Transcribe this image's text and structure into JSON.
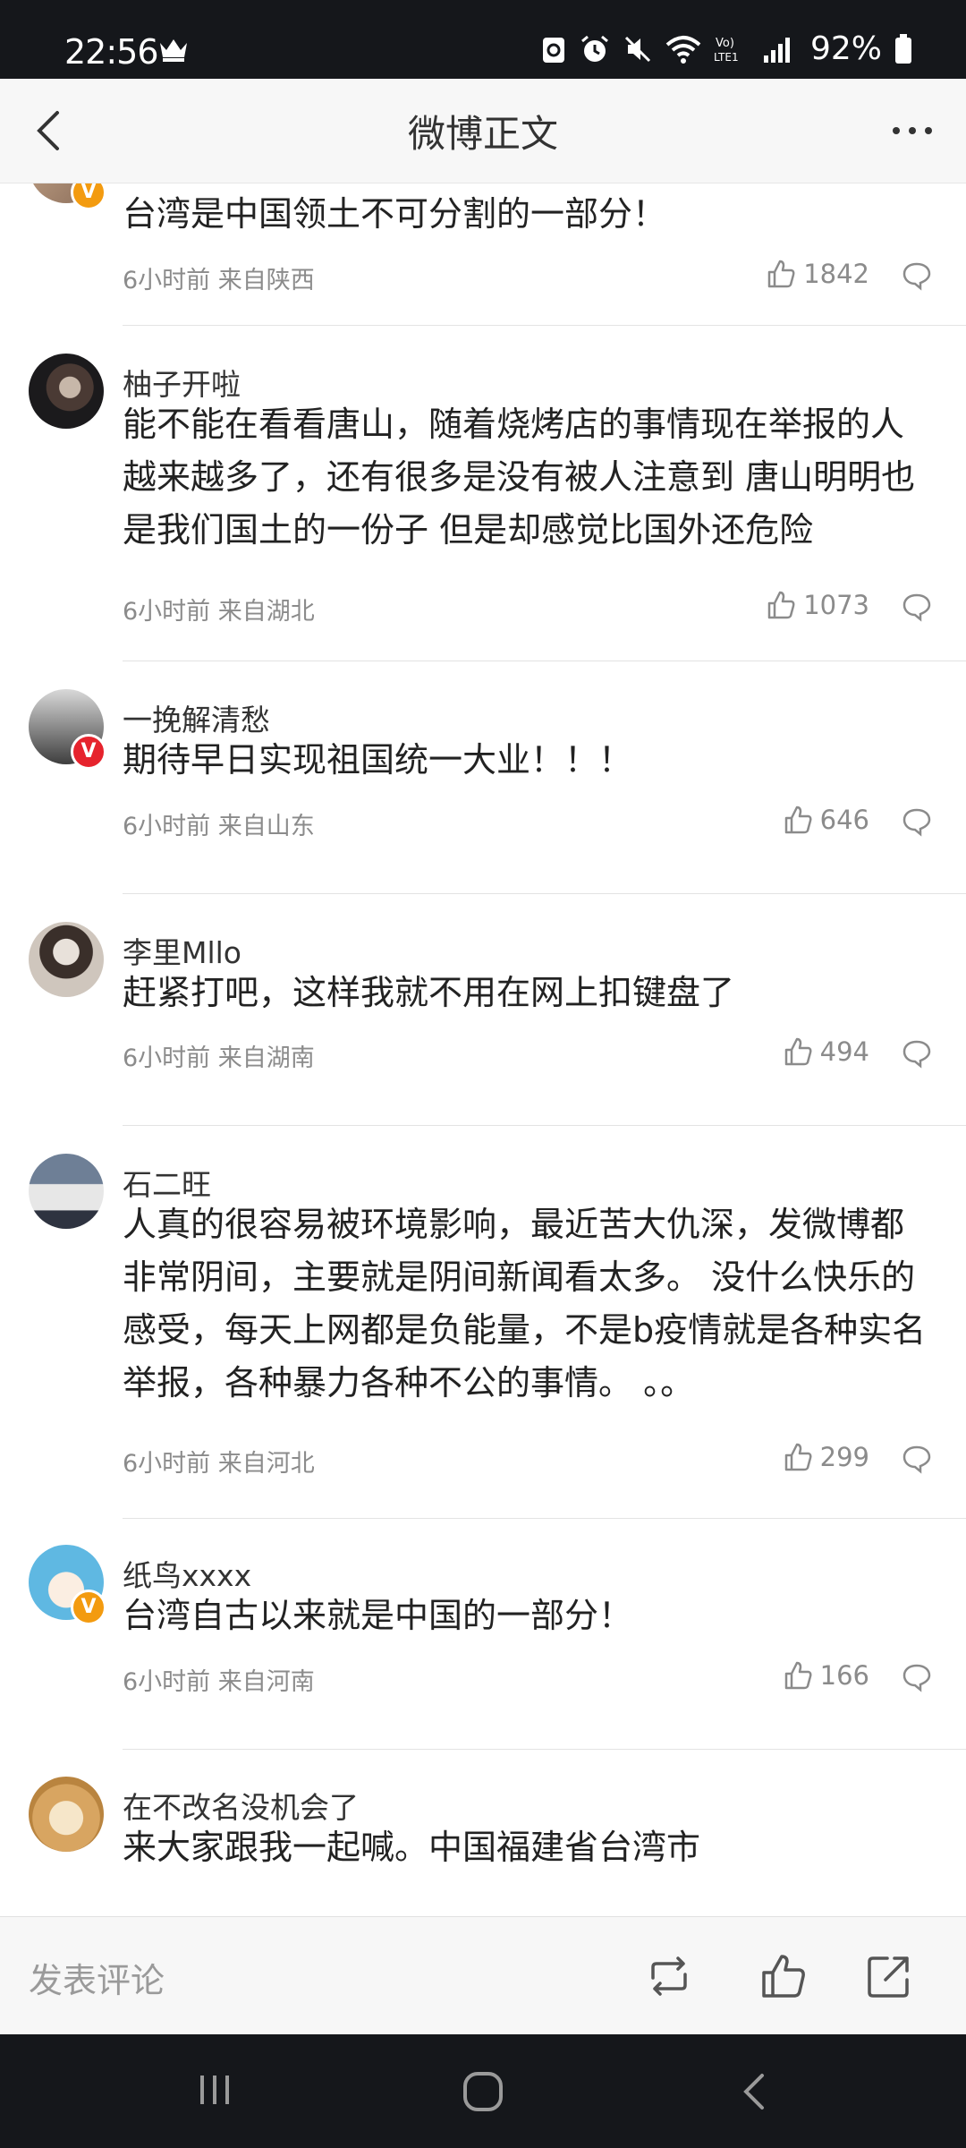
{
  "status_bar": {
    "time": "22:56",
    "battery": "92%",
    "icons": [
      "crown-icon",
      "recycle-icon",
      "alarm-icon",
      "mute-icon",
      "wifi-icon",
      "volte-icon",
      "signal-icon",
      "battery-icon"
    ]
  },
  "header": {
    "title": "微博正文"
  },
  "comments": [
    {
      "name": "",
      "text": "台湾是中国领土不可分割的一部分！",
      "meta": "6小时前 来自陕西",
      "likes": "1842",
      "badge": "orange"
    },
    {
      "name": "柚子开啦",
      "text": "能不能在看看唐山，随着烧烤店的事情现在举报的人越来越多了，还有很多是没有被人注意到 唐山明明也是我们国土的一份子 但是却感觉比国外还危险",
      "meta": "6小时前 来自湖北",
      "likes": "1073",
      "badge": ""
    },
    {
      "name": "一挽解清愁",
      "text": "期待早日实现祖国统一大业！！！",
      "meta": "6小时前 来自山东",
      "likes": "646",
      "badge": "red"
    },
    {
      "name": "李里Mllo",
      "text": "赶紧打吧，这样我就不用在网上扣键盘了",
      "meta": "6小时前 来自湖南",
      "likes": "494",
      "badge": ""
    },
    {
      "name": "石二旺",
      "text": "人真的很容易被环境影响，最近苦大仇深，发微博都非常阴间，主要就是阴间新闻看太多。 没什么快乐的感受，每天上网都是负能量，不是b疫情就是各种实名举报，各种暴力各种不公的事情。 。。",
      "meta": "6小时前 来自河北",
      "likes": "299",
      "badge": ""
    },
    {
      "name": "纸鸟xxxx",
      "text": "台湾自古以来就是中国的一部分！",
      "meta": "6小时前 来自河南",
      "likes": "166",
      "badge": "orange"
    },
    {
      "name": "在不改名没机会了",
      "text": "来大家跟我一起喊。中国福建省台湾市",
      "meta": "",
      "likes": "",
      "badge": ""
    }
  ],
  "badge_letter": "V",
  "bottom_bar": {
    "comment_placeholder": "发表评论",
    "icons": [
      "repost-icon",
      "like-icon",
      "share-icon"
    ]
  },
  "colors": {
    "status_bg": "#15171b",
    "badge_orange": "#f39b10",
    "badge_red": "#e6232d",
    "meta_gray": "#8b8b8b"
  }
}
